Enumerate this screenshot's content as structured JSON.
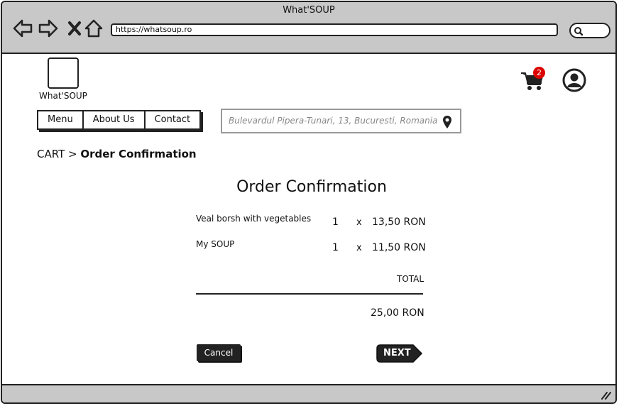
{
  "window": {
    "title": "What'SOUP",
    "url": "https://whatsoup.ro"
  },
  "header": {
    "logo_text": "What'SOUP",
    "cart_count": "2"
  },
  "nav": {
    "items": [
      {
        "label": "Menu"
      },
      {
        "label": "About Us"
      },
      {
        "label": "Contact"
      }
    ],
    "address": "Bulevardul Pipera-Tunari, 13, Bucuresti, Romania"
  },
  "breadcrumb": {
    "root": "CART",
    "separator": ">",
    "current": "Order Confirmation"
  },
  "order": {
    "heading": "Order Confirmation",
    "items": [
      {
        "name": "Veal borsh with vegetables",
        "qty": "1",
        "times": "x",
        "price": "13,50 RON"
      },
      {
        "name": "My SOUP",
        "qty": "1",
        "times": "x",
        "price": "11,50 RON"
      }
    ],
    "total_label": "TOTAL",
    "total_value": "25,00 RON"
  },
  "actions": {
    "cancel_label": "Cancel",
    "next_label": "NEXT"
  },
  "icons": {
    "back": "back-arrow-icon",
    "forward": "forward-arrow-icon",
    "close": "close-x-icon",
    "home": "home-icon",
    "search": "search-icon",
    "cart": "shopping-cart-icon",
    "user": "user-avatar-icon",
    "location": "location-pin-icon"
  }
}
